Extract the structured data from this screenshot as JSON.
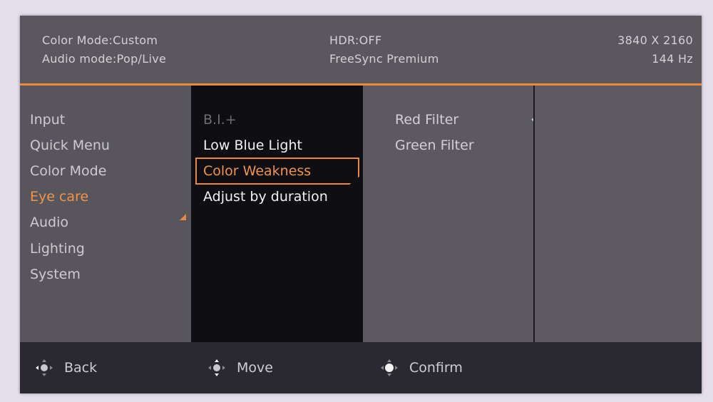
{
  "status": {
    "color_mode": "Color Mode:Custom",
    "audio_mode": "Audio mode:Pop/Live",
    "hdr": "HDR:OFF",
    "freesync": "FreeSync Premium",
    "resolution": "3840 X 2160",
    "refresh_rate": "144 Hz"
  },
  "main_menu": [
    {
      "label": "Input"
    },
    {
      "label": "Quick Menu"
    },
    {
      "label": "Color Mode"
    },
    {
      "label": "Eye care"
    },
    {
      "label": "Audio"
    },
    {
      "label": "Lighting"
    },
    {
      "label": "System"
    }
  ],
  "main_menu_active": "Eye care",
  "eye_care_menu": [
    {
      "label": "B.I.+"
    },
    {
      "label": "Low Blue Light"
    },
    {
      "label": "Color Weakness"
    },
    {
      "label": "Adjust by duration"
    }
  ],
  "eye_care_selected": "Color Weakness",
  "color_weakness_options": [
    {
      "label": "Red Filter"
    },
    {
      "label": "Green Filter"
    }
  ],
  "color_weakness_checked": "Red Filter",
  "footer": {
    "back": "Back",
    "move": "Move",
    "confirm": "Confirm"
  },
  "icons": {
    "navigation": "dpad-icon",
    "checked": "checkmark-icon",
    "active_marker": "triangle-marker-icon"
  },
  "colors": {
    "accent": "#e98a3c",
    "panel": "#555359",
    "submenu": "#0f0e12",
    "footer": "#2a2830"
  }
}
